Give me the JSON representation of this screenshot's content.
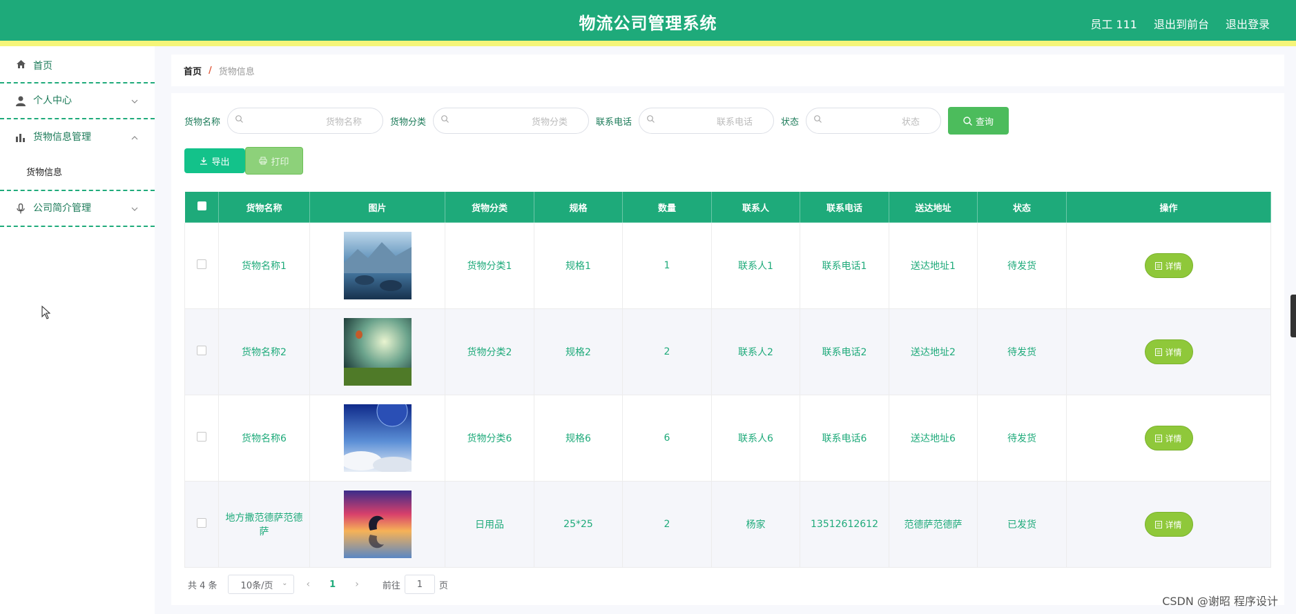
{
  "header": {
    "title": "物流公司管理系统",
    "user": "员工 111",
    "to_front": "退出到前台",
    "logout": "退出登录"
  },
  "sidebar": {
    "items": [
      {
        "label": "首页",
        "icon": "home-icon"
      },
      {
        "label": "个人中心",
        "icon": "user-icon"
      },
      {
        "label": "货物信息管理",
        "icon": "bar-chart-icon"
      },
      {
        "label": "公司简介管理",
        "icon": "microphone-icon"
      }
    ],
    "sub_item": "货物信息"
  },
  "breadcrumb": {
    "home": "首页",
    "sep": "/",
    "current": "货物信息"
  },
  "search": {
    "name_label": "货物名称",
    "name_placeholder": "货物名称",
    "category_label": "货物分类",
    "category_placeholder": "货物分类",
    "phone_label": "联系电话",
    "phone_placeholder": "联系电话",
    "status_label": "状态",
    "status_placeholder": "状态",
    "query_label": "查询"
  },
  "actions": {
    "export_label": "导出",
    "print_label": "打印"
  },
  "table": {
    "columns": [
      "货物名称",
      "图片",
      "货物分类",
      "规格",
      "数量",
      "联系人",
      "联系电话",
      "送达地址",
      "状态",
      "操作"
    ],
    "detail_label": "详情",
    "rows": [
      {
        "name": "货物名称1",
        "category": "货物分类1",
        "spec": "规格1",
        "qty": "1",
        "contact": "联系人1",
        "phone": "联系电话1",
        "address": "送达地址1",
        "status": "待发货"
      },
      {
        "name": "货物名称2",
        "category": "货物分类2",
        "spec": "规格2",
        "qty": "2",
        "contact": "联系人2",
        "phone": "联系电话2",
        "address": "送达地址2",
        "status": "待发货"
      },
      {
        "name": "货物名称6",
        "category": "货物分类6",
        "spec": "规格6",
        "qty": "6",
        "contact": "联系人6",
        "phone": "联系电话6",
        "address": "送达地址6",
        "status": "待发货"
      },
      {
        "name": "地方撒范德萨范德萨",
        "category": "日用品",
        "spec": "25*25",
        "qty": "2",
        "contact": "杨家",
        "phone": "13512612612",
        "address": "范德萨范德萨",
        "status": "已发货"
      }
    ]
  },
  "pagination": {
    "total": "共 4 条",
    "page_size": "10条/页",
    "current": "1",
    "goto_prefix": "前往",
    "goto_value": "1",
    "goto_suffix": "页"
  },
  "watermark": "CSDN @谢昭  程序设计"
}
